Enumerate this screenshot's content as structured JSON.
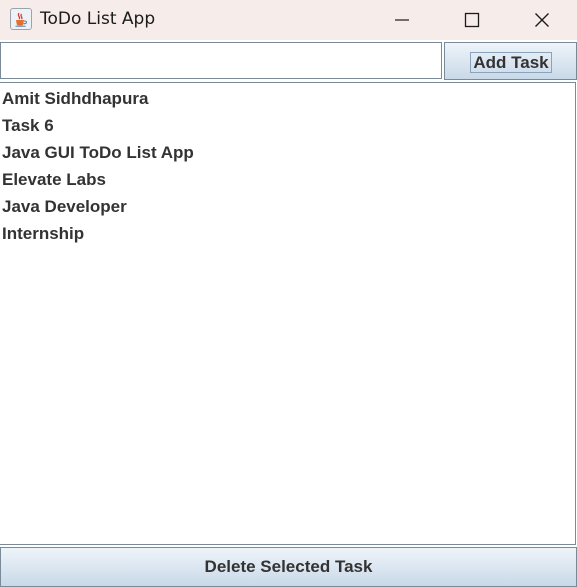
{
  "window": {
    "title": "ToDo List App",
    "app_icon": "java-coffee-cup-icon",
    "controls": [
      "minimize-icon",
      "maximize-icon",
      "close-icon"
    ]
  },
  "input": {
    "value": "",
    "placeholder": ""
  },
  "add_button": {
    "label": "Add Task"
  },
  "tasks": [
    "Amit Sidhdhapura",
    "Task 6",
    "Java GUI ToDo List App",
    "Elevate Labs",
    "Java Developer",
    "Internship"
  ],
  "delete_button": {
    "label": "Delete Selected Task"
  },
  "colors": {
    "titlebar": "#f6ecea",
    "button_gradient_top": "#eef4fa",
    "button_gradient_bottom": "#c9d9e8",
    "border": "#7a8a99",
    "text": "#333333"
  }
}
